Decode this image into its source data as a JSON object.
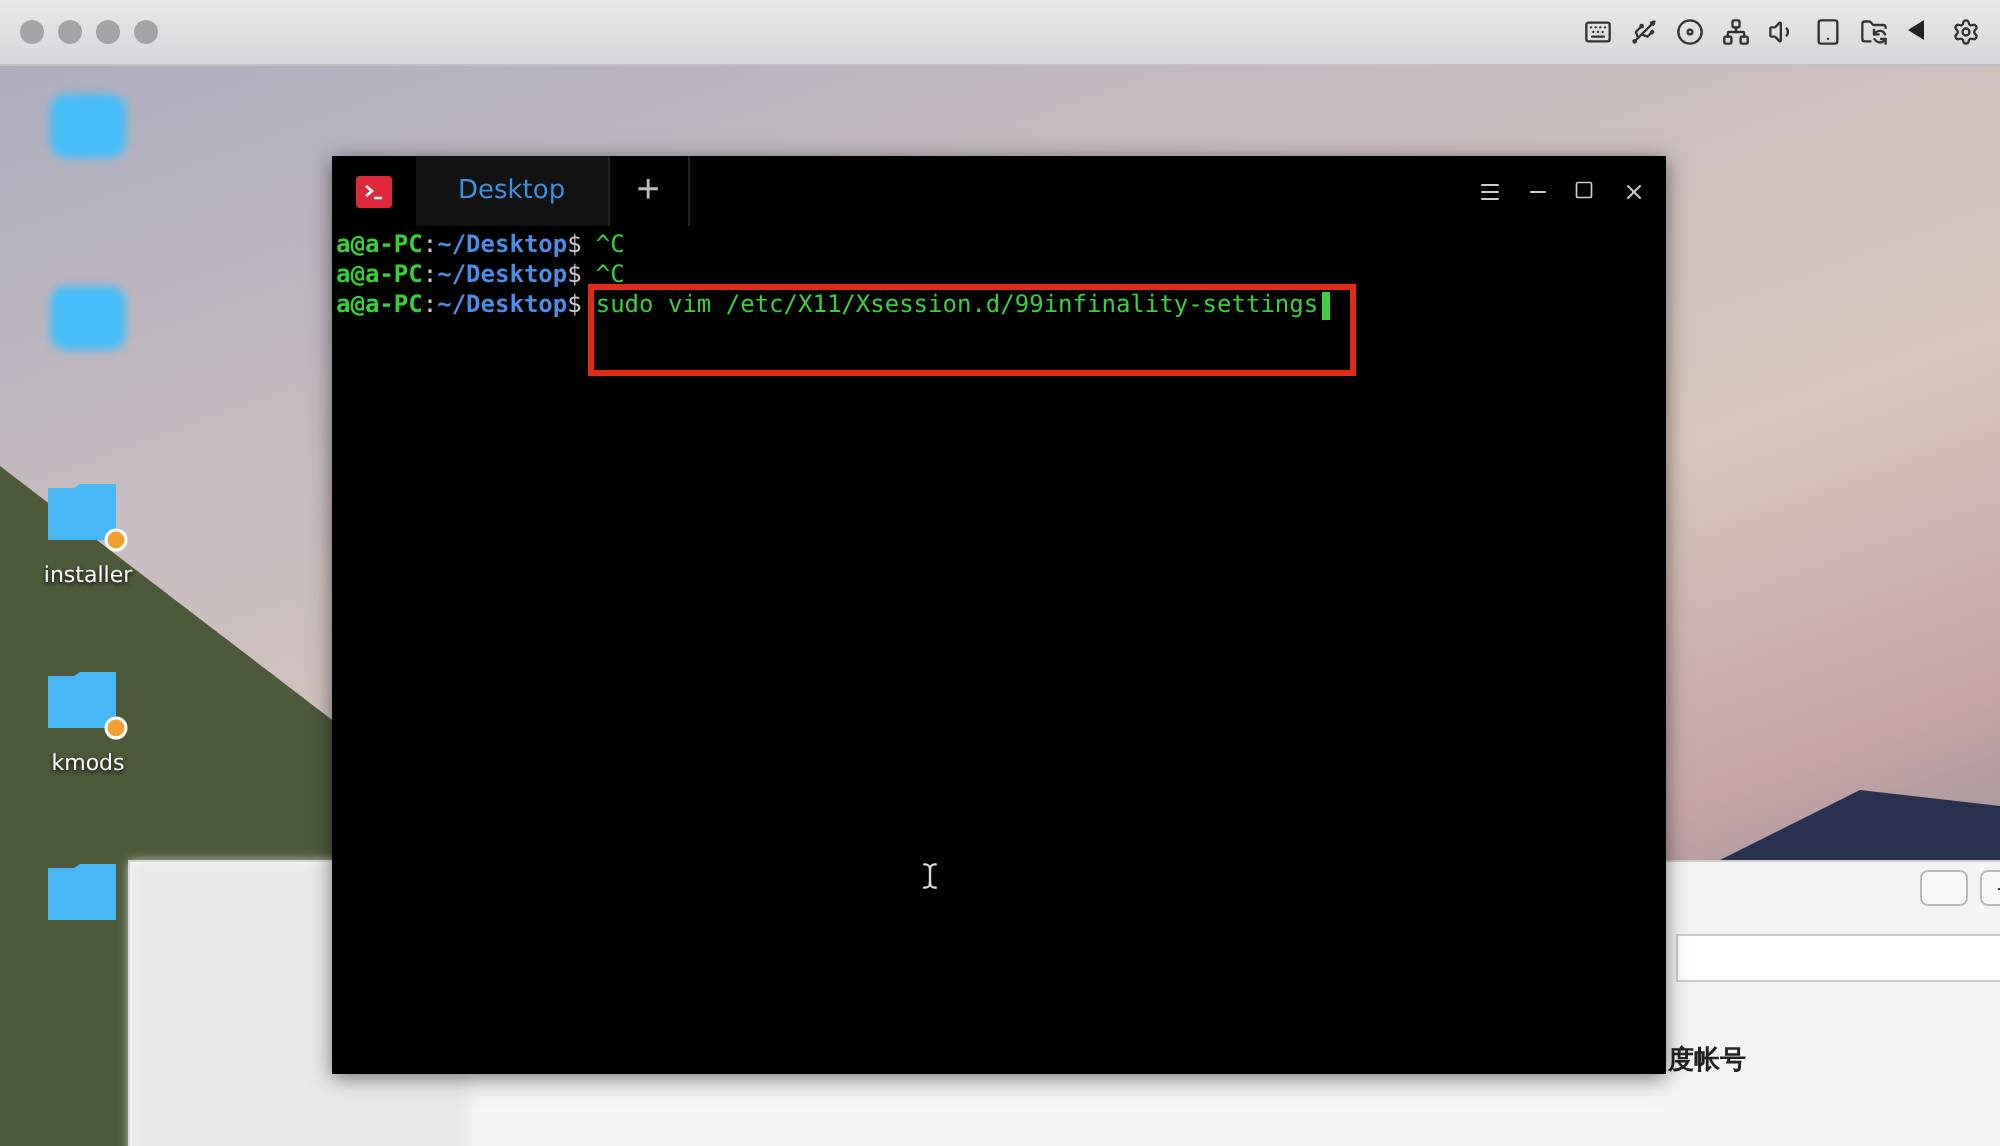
{
  "desktop_icons": [
    {
      "kind": "app"
    },
    {
      "kind": "app"
    },
    {
      "kind": "folder",
      "label": "installer",
      "badge": true
    },
    {
      "kind": "folder",
      "label": "kmods",
      "badge": true
    },
    {
      "kind": "folder",
      "badge": false
    }
  ],
  "terminal": {
    "tabs": [
      {
        "label": "Desktop",
        "selected": true
      }
    ],
    "new_tab": "+",
    "lines": [
      {
        "user": "a@a-PC",
        "separator": ":",
        "path": "~/Desktop",
        "sign": "$",
        "command": "^C",
        "highlight": false,
        "cursor": false
      },
      {
        "user": "a@a-PC",
        "separator": ":",
        "path": "~/Desktop",
        "sign": "$",
        "command": "^C",
        "highlight": false,
        "cursor": false
      },
      {
        "user": "a@a-PC",
        "separator": ":",
        "path": "~/Desktop",
        "sign": "$",
        "command": "sudo vim /etc/X11/Xsession.d/99infinality-settings",
        "highlight": true,
        "cursor": true
      }
    ]
  },
  "browser": {
    "account_label": "度帐号"
  }
}
